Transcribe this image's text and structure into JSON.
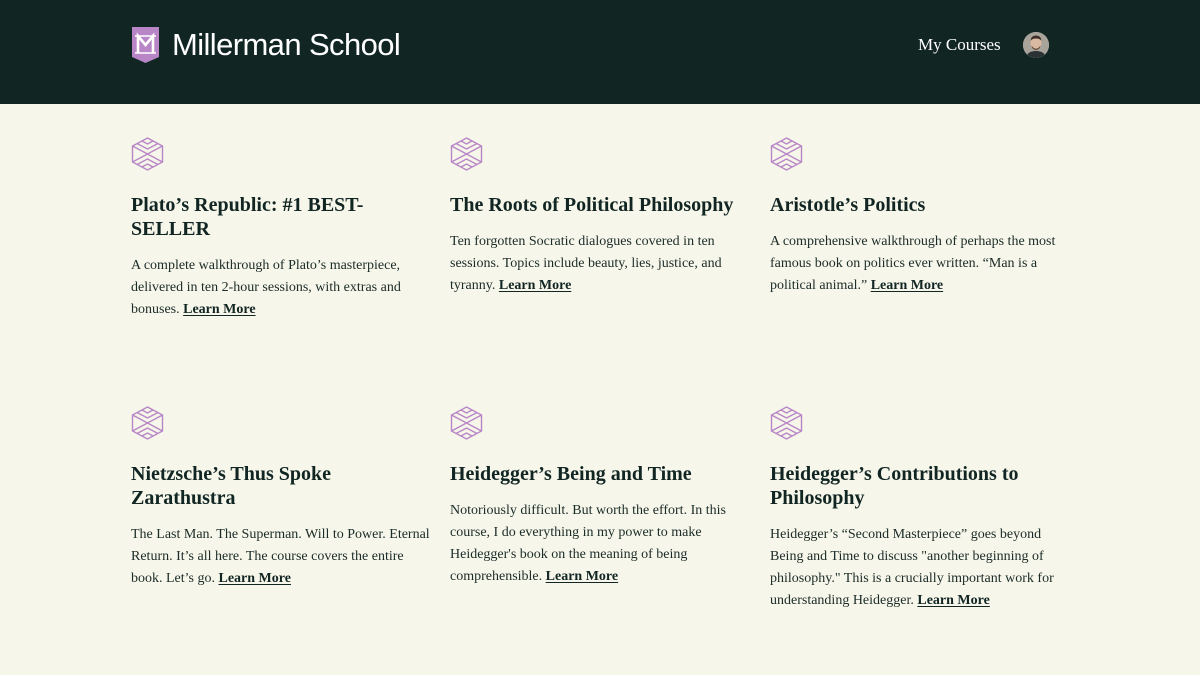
{
  "header": {
    "brand_name": "Millerman School",
    "logo_icon": "millerman-m-shield-icon",
    "nav": {
      "my_courses": "My Courses"
    },
    "avatar_icon": "user-avatar",
    "colors": {
      "header_bg": "#112523",
      "page_bg": "#f6f6ea",
      "accent": "#b886c6"
    }
  },
  "courses": [
    {
      "icon": "hexagon-star-icon",
      "title": "Plato’s Republic: #1 BEST-SELLER",
      "description": "A complete walkthrough of Plato’s masterpiece, delivered in ten 2-hour sessions, with extras and bonuses.",
      "link": "Learn More"
    },
    {
      "icon": "hexagon-star-icon",
      "title": "The Roots of Political Philosophy",
      "description": "Ten forgotten Socratic dialogues covered in ten sessions. Topics include beauty, lies, justice, and tyranny.",
      "link": "Learn More"
    },
    {
      "icon": "hexagon-star-icon",
      "title": "Aristotle’s Politics",
      "description": "A comprehensive walkthrough of perhaps the most famous book on politics ever written. “Man is a political animal.”",
      "link": "Learn More"
    },
    {
      "icon": "hexagon-star-icon",
      "title": "Nietzsche’s Thus Spoke Zarathustra",
      "description": "The Last Man. The Superman. Will to Power. Eternal Return. It’s all here. The course covers the entire book. Let’s go.",
      "link": "Learn More"
    },
    {
      "icon": "hexagon-star-icon",
      "title": "Heidegger’s Being and Time",
      "description": "Notoriously difficult. But worth the effort. In this course, I do everything in my power to make Heidegger's book on the meaning of being comprehensible.",
      "link": "Learn More"
    },
    {
      "icon": "hexagon-star-icon",
      "title": "Heidegger’s Contributions to Philosophy",
      "description": "Heidegger’s “Second Masterpiece” goes beyond Being and Time to discuss \"another beginning of philosophy.\" This is a crucially important work for understanding Heidegger.",
      "link": "Learn More"
    }
  ]
}
